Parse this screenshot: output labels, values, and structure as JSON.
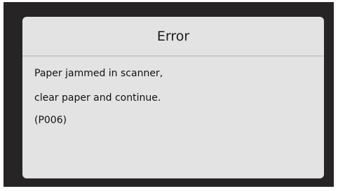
{
  "dialog": {
    "title": "Error",
    "message_lines": [
      "Paper jammed in scanner,",
      "clear paper and continue.",
      "(P006)"
    ]
  },
  "colors": {
    "bezel": "#262424",
    "dialog_background": "#e3e3e3",
    "divider": "#c9c9c9",
    "text": "#111111"
  }
}
